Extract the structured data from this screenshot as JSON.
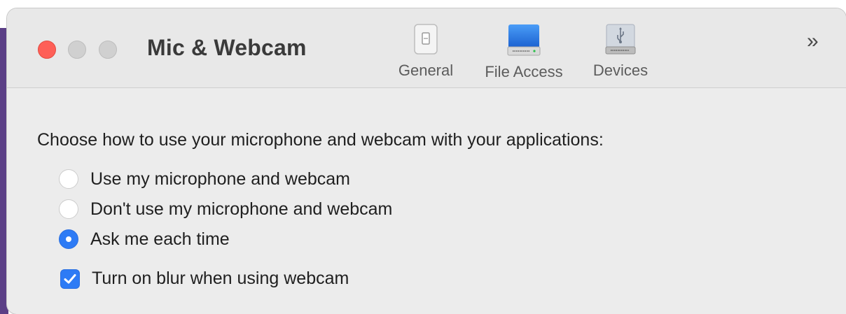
{
  "window": {
    "title": "Mic & Webcam"
  },
  "toolbar": {
    "items": [
      {
        "label": "General",
        "icon": "switch-icon"
      },
      {
        "label": "File Access",
        "icon": "hard-drive-icon"
      },
      {
        "label": "Devices",
        "icon": "usb-drive-icon"
      }
    ],
    "overflow_symbol": "»"
  },
  "content": {
    "prompt": "Choose how to use your microphone and webcam with your applications:",
    "options": [
      {
        "label": "Use my microphone and webcam",
        "selected": false
      },
      {
        "label": "Don't use my microphone and webcam",
        "selected": false
      },
      {
        "label": "Ask me each time",
        "selected": true
      }
    ],
    "blur_checkbox": {
      "label": "Turn on blur when using webcam",
      "checked": true
    }
  },
  "colors": {
    "accent": "#2d7bf5",
    "close_button": "#fe5f57",
    "inactive_button": "#d0d0d0",
    "window_bg": "#ececec"
  }
}
